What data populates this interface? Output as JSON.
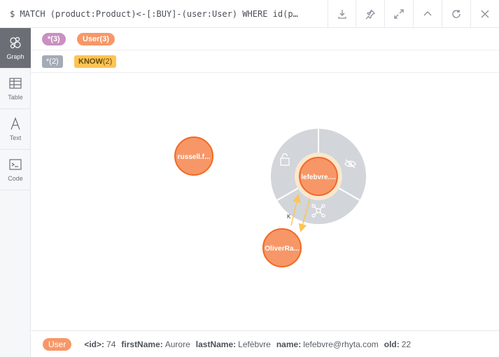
{
  "query": "$ MATCH (product:Product)<-[:BUY]-(user:User) WHERE id(p…",
  "toolbar": {
    "download": "download-icon",
    "pin": "pin-icon",
    "expand": "expand-icon",
    "collapse": "chevron-up-icon",
    "rerun": "refresh-icon",
    "close": "close-icon"
  },
  "sidebar": {
    "items": [
      {
        "label": "Graph",
        "icon": "graph-icon",
        "active": true
      },
      {
        "label": "Table",
        "icon": "table-icon",
        "active": false
      },
      {
        "label": "Text",
        "icon": "text-icon",
        "active": false
      },
      {
        "label": "Code",
        "icon": "code-icon",
        "active": false
      }
    ]
  },
  "legend": {
    "nodes": [
      {
        "label": "*(3)",
        "color": "#c990c0"
      },
      {
        "label": "User(3)",
        "color": "#f79767"
      }
    ],
    "relationships": [
      {
        "label": "*(2)",
        "color": "#a5abb6"
      },
      {
        "label": "KNOW",
        "count": "(2)",
        "color": "#ffc454"
      }
    ]
  },
  "graph": {
    "nodes": [
      {
        "caption": "russell.f...",
        "color": "#f79767",
        "border": "#f36924"
      },
      {
        "caption": "lefebvre....",
        "color": "#f79767",
        "border": "#f36924",
        "selected": true
      },
      {
        "caption": "OliverRa...",
        "color": "#f79767",
        "border": "#f36924"
      }
    ],
    "relationship_label": "K",
    "ring_icons": [
      "lock-icon",
      "eye-hide-icon",
      "expand-neighbors-icon"
    ]
  },
  "footer": {
    "badge": "User",
    "props": [
      {
        "key": "<id>:",
        "value": "74"
      },
      {
        "key": "firstName:",
        "value": "Aurore"
      },
      {
        "key": "lastName:",
        "value": "Lefèbvre"
      },
      {
        "key": "name:",
        "value": "lefebvre@rhyta.com"
      },
      {
        "key": "old:",
        "value": "22"
      }
    ]
  }
}
